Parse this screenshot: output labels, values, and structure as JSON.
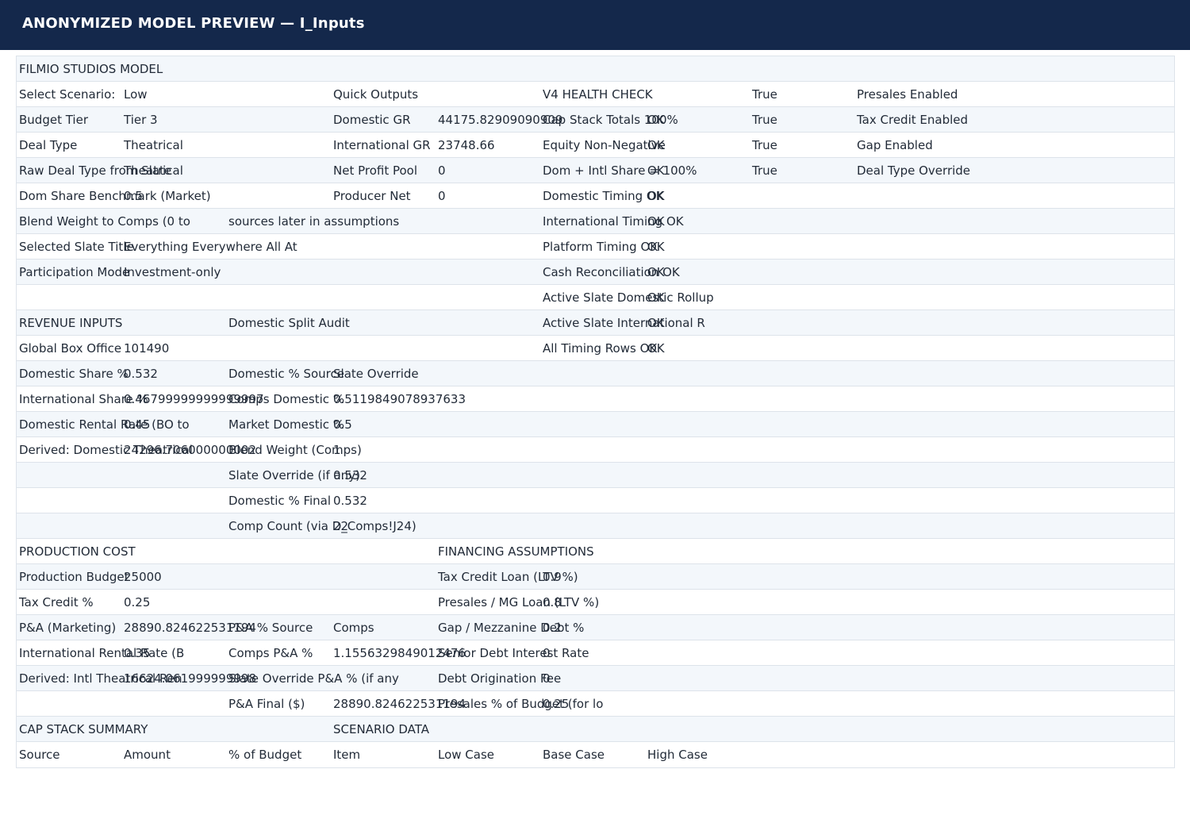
{
  "window": {
    "title": "ANONYMIZED MODEL PREVIEW — I_Inputs"
  },
  "sheet": {
    "rows": [
      [
        {
          "c": 0,
          "t": "FILMIO STUDIOS MODEL"
        }
      ],
      [
        {
          "c": 0,
          "t": "Select Scenario:"
        },
        {
          "c": 1,
          "t": "Low"
        },
        {
          "c": 3,
          "t": "Quick Outputs"
        },
        {
          "c": 5,
          "t": "V4 HEALTH CHECK"
        },
        {
          "c": 7,
          "t": "True"
        },
        {
          "c": 8,
          "t": "Presales Enabled"
        }
      ],
      [
        {
          "c": 0,
          "t": "Budget Tier"
        },
        {
          "c": 1,
          "t": "Tier 3"
        },
        {
          "c": 3,
          "t": "Domestic GR"
        },
        {
          "c": 4,
          "t": "44175.82909090909"
        },
        {
          "c": 5,
          "t": "Cap Stack Totals 100%"
        },
        {
          "c": 6,
          "t": "OK"
        },
        {
          "c": 7,
          "t": "True"
        },
        {
          "c": 8,
          "t": "Tax Credit Enabled"
        }
      ],
      [
        {
          "c": 0,
          "t": "Deal Type"
        },
        {
          "c": 1,
          "t": "Theatrical"
        },
        {
          "c": 3,
          "t": "International GR"
        },
        {
          "c": 4,
          "t": "23748.66"
        },
        {
          "c": 5,
          "t": "Equity Non-Negative"
        },
        {
          "c": 6,
          "t": "OK"
        },
        {
          "c": 7,
          "t": "True"
        },
        {
          "c": 8,
          "t": "Gap Enabled"
        }
      ],
      [
        {
          "c": 0,
          "t": "Raw Deal Type from Slate"
        },
        {
          "c": 1,
          "t": "Theatrical"
        },
        {
          "c": 3,
          "t": "Net Profit Pool"
        },
        {
          "c": 4,
          "t": "0"
        },
        {
          "c": 5,
          "t": "Dom + Intl Share = 100%"
        },
        {
          "c": 6,
          "t": "OK"
        },
        {
          "c": 7,
          "t": "True"
        },
        {
          "c": 8,
          "t": "Deal Type Override"
        }
      ],
      [
        {
          "c": 0,
          "t": "Dom Share Benchmark (Market)"
        },
        {
          "c": 1,
          "t": "0.5"
        },
        {
          "c": 3,
          "t": "Producer Net"
        },
        {
          "c": 4,
          "t": "0"
        },
        {
          "c": 5,
          "t": "Domestic Timing OK"
        },
        {
          "c": 6,
          "t": "OK"
        }
      ],
      [
        {
          "c": 0,
          "t": "Blend Weight to Comps (0 to"
        },
        {
          "c": 2,
          "t": "sources later in assumptions"
        },
        {
          "c": 5,
          "t": "International Timing OK"
        },
        {
          "c": 6,
          "t": "OK"
        }
      ],
      [
        {
          "c": 0,
          "t": "Selected Slate Title"
        },
        {
          "c": 1,
          "t": "Everything Everywhere All At"
        },
        {
          "c": 5,
          "t": "Platform Timing OK"
        },
        {
          "c": 6,
          "t": "OK"
        }
      ],
      [
        {
          "c": 0,
          "t": "Participation Mode"
        },
        {
          "c": 1,
          "t": "Investment-only"
        },
        {
          "c": 5,
          "t": "Cash Reconciliation OK"
        },
        {
          "c": 6,
          "t": "OK"
        }
      ],
      [
        {
          "c": 5,
          "t": "Active Slate Domestic Rollup"
        },
        {
          "c": 6,
          "t": "OK"
        }
      ],
      [
        {
          "c": 0,
          "t": "REVENUE INPUTS"
        },
        {
          "c": 2,
          "t": "Domestic Split Audit"
        },
        {
          "c": 5,
          "t": "Active Slate International R"
        },
        {
          "c": 6,
          "t": "OK"
        }
      ],
      [
        {
          "c": 0,
          "t": "Global Box Office"
        },
        {
          "c": 1,
          "t": "101490"
        },
        {
          "c": 5,
          "t": "All Timing Rows OK"
        },
        {
          "c": 6,
          "t": "OK"
        }
      ],
      [
        {
          "c": 0,
          "t": "Domestic Share %"
        },
        {
          "c": 1,
          "t": "0.532"
        },
        {
          "c": 2,
          "t": "Domestic % Source"
        },
        {
          "c": 3,
          "t": "Slate Override"
        }
      ],
      [
        {
          "c": 0,
          "t": "International Share %"
        },
        {
          "c": 1,
          "t": "0.46799999999999997"
        },
        {
          "c": 2,
          "t": "Comps Domestic %"
        },
        {
          "c": 3,
          "t": "0.5119849078937633"
        }
      ],
      [
        {
          "c": 0,
          "t": "Domestic Rental Rate (BO to"
        },
        {
          "c": 1,
          "t": "0.45"
        },
        {
          "c": 2,
          "t": "Market Domestic %"
        },
        {
          "c": 3,
          "t": "0.5"
        }
      ],
      [
        {
          "c": 0,
          "t": "Derived: Domestic Theatrical"
        },
        {
          "c": 1,
          "t": "24296.706000000002"
        },
        {
          "c": 2,
          "t": "Blend Weight (Comps)"
        },
        {
          "c": 3,
          "t": "1"
        }
      ],
      [
        {
          "c": 2,
          "t": "Slate Override (if any)"
        },
        {
          "c": 3,
          "t": "0.532"
        }
      ],
      [
        {
          "c": 2,
          "t": "Domestic % Final"
        },
        {
          "c": 3,
          "t": "0.532"
        }
      ],
      [
        {
          "c": 2,
          "t": "Comp Count (via D_Comps!J24)"
        },
        {
          "c": 3,
          "t": "22"
        }
      ],
      [
        {
          "c": 0,
          "t": "PRODUCTION COST"
        },
        {
          "c": 4,
          "t": "FINANCING ASSUMPTIONS"
        }
      ],
      [
        {
          "c": 0,
          "t": "Production Budget"
        },
        {
          "c": 1,
          "t": "25000"
        },
        {
          "c": 4,
          "t": "Tax Credit Loan (LTV %)"
        },
        {
          "c": 5,
          "t": "0.9"
        }
      ],
      [
        {
          "c": 0,
          "t": "Tax Credit %"
        },
        {
          "c": 1,
          "t": "0.25"
        },
        {
          "c": 4,
          "t": "Presales / MG Loan (LTV %)"
        },
        {
          "c": 5,
          "t": "0.8"
        }
      ],
      [
        {
          "c": 0,
          "t": "P&A (Marketing)"
        },
        {
          "c": 1,
          "t": "28890.824622531194"
        },
        {
          "c": 2,
          "t": "P&A % Source"
        },
        {
          "c": 3,
          "t": "Comps"
        },
        {
          "c": 4,
          "t": "Gap / Mezzanine Debt %"
        },
        {
          "c": 5,
          "t": "0.2"
        }
      ],
      [
        {
          "c": 0,
          "t": "International Rental Rate (B"
        },
        {
          "c": 1,
          "t": "0.35"
        },
        {
          "c": 2,
          "t": "Comps P&A %"
        },
        {
          "c": 3,
          "t": "1.1556329849012476"
        },
        {
          "c": 4,
          "t": "Senior Debt Interest Rate"
        },
        {
          "c": 5,
          "t": "0"
        }
      ],
      [
        {
          "c": 0,
          "t": "Derived: Intl Theatrical Ren"
        },
        {
          "c": 1,
          "t": "16624.061999999998"
        },
        {
          "c": 2,
          "t": "Slate Override P&A % (if any"
        },
        {
          "c": 4,
          "t": "Debt Origination Fee"
        },
        {
          "c": 5,
          "t": "0"
        }
      ],
      [
        {
          "c": 2,
          "t": "P&A Final ($)"
        },
        {
          "c": 3,
          "t": "28890.824622531194"
        },
        {
          "c": 4,
          "t": "Presales % of Budget (for lo"
        },
        {
          "c": 5,
          "t": "0.25"
        }
      ],
      [
        {
          "c": 0,
          "t": "CAP STACK SUMMARY"
        },
        {
          "c": 3,
          "t": "SCENARIO DATA"
        }
      ],
      [
        {
          "c": 0,
          "t": "Source"
        },
        {
          "c": 1,
          "t": "Amount"
        },
        {
          "c": 2,
          "t": "% of Budget"
        },
        {
          "c": 3,
          "t": "Item"
        },
        {
          "c": 4,
          "t": "Low Case"
        },
        {
          "c": 5,
          "t": "Base Case"
        },
        {
          "c": 6,
          "t": "High Case"
        }
      ]
    ]
  }
}
